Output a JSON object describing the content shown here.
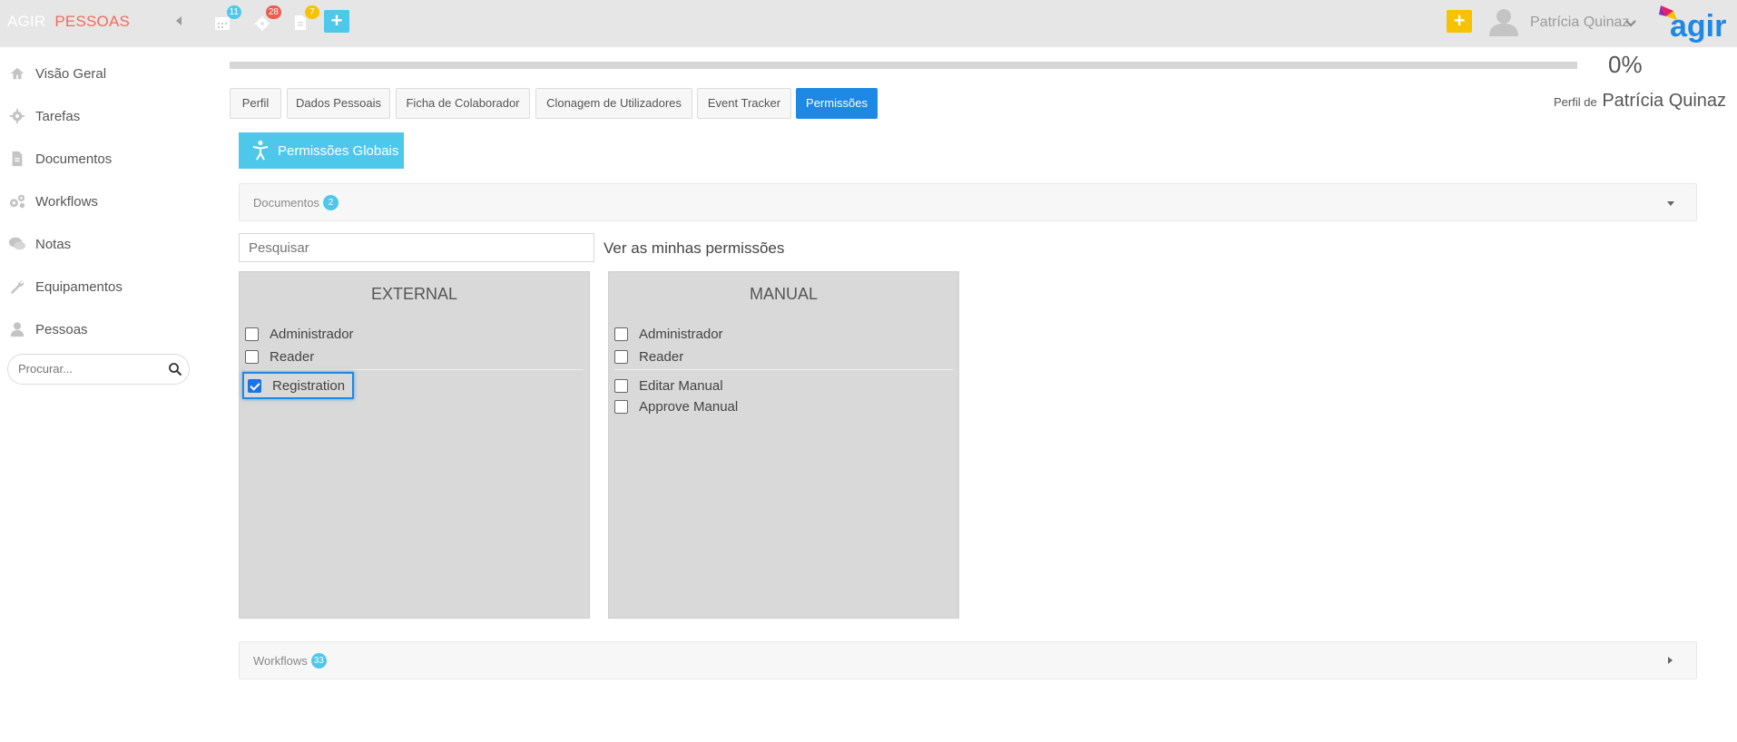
{
  "header": {
    "brand_part1": "AGIR",
    "brand_part2": "PESSOAS",
    "notifications": [
      {
        "icon": "calendar-icon",
        "count": "11",
        "color": "#4ec8ea"
      },
      {
        "icon": "gear-icon",
        "count": "28",
        "color": "#f05a4f"
      },
      {
        "icon": "document-icon",
        "count": "7",
        "color": "#f7c200"
      }
    ],
    "add_label": "+",
    "quick_add_label": "+",
    "user_name": "Patrícia Quinaz",
    "logo_text": "agir"
  },
  "sidebar": {
    "items": [
      {
        "label": "Visão Geral",
        "icon": "home-icon"
      },
      {
        "label": "Tarefas",
        "icon": "gear-icon"
      },
      {
        "label": "Documentos",
        "icon": "document-icon"
      },
      {
        "label": "Workflows",
        "icon": "gears-icon"
      },
      {
        "label": "Notas",
        "icon": "chat-icon"
      },
      {
        "label": "Equipamentos",
        "icon": "wrench-icon"
      },
      {
        "label": "Pessoas",
        "icon": "person-icon"
      }
    ],
    "search_placeholder": "Procurar..."
  },
  "main": {
    "progress_percent": 0,
    "progress_label": "0%",
    "tabs": [
      {
        "label": "Perfil",
        "active": false
      },
      {
        "label": "Dados Pessoais",
        "active": false
      },
      {
        "label": "Ficha de Colaborador",
        "active": false
      },
      {
        "label": "Clonagem de Utilizadores",
        "active": false
      },
      {
        "label": "Event Tracker",
        "active": false
      },
      {
        "label": "Permissões",
        "active": true
      }
    ],
    "profile_of_label": "Perfil de",
    "profile_name": "Patrícia Quinaz",
    "global_permissions_label": "Permissões Globais",
    "documents_panel": {
      "title": "Documentos",
      "count": "2"
    },
    "search_placeholder": "Pesquisar",
    "my_permissions_label": "Ver as minhas permissões",
    "boxes": [
      {
        "title": "EXTERNAL",
        "roles": [
          {
            "label": "Administrador",
            "checked": false
          },
          {
            "label": "Reader",
            "checked": false
          }
        ],
        "extra": [
          {
            "label": "Registration",
            "checked": true
          }
        ]
      },
      {
        "title": "MANUAL",
        "roles": [
          {
            "label": "Administrador",
            "checked": false
          },
          {
            "label": "Reader",
            "checked": false
          }
        ],
        "extra": [
          {
            "label": "Editar Manual",
            "checked": false
          },
          {
            "label": "Approve Manual",
            "checked": false
          }
        ]
      }
    ],
    "workflows_panel": {
      "title": "Workflows",
      "count": "33"
    }
  }
}
